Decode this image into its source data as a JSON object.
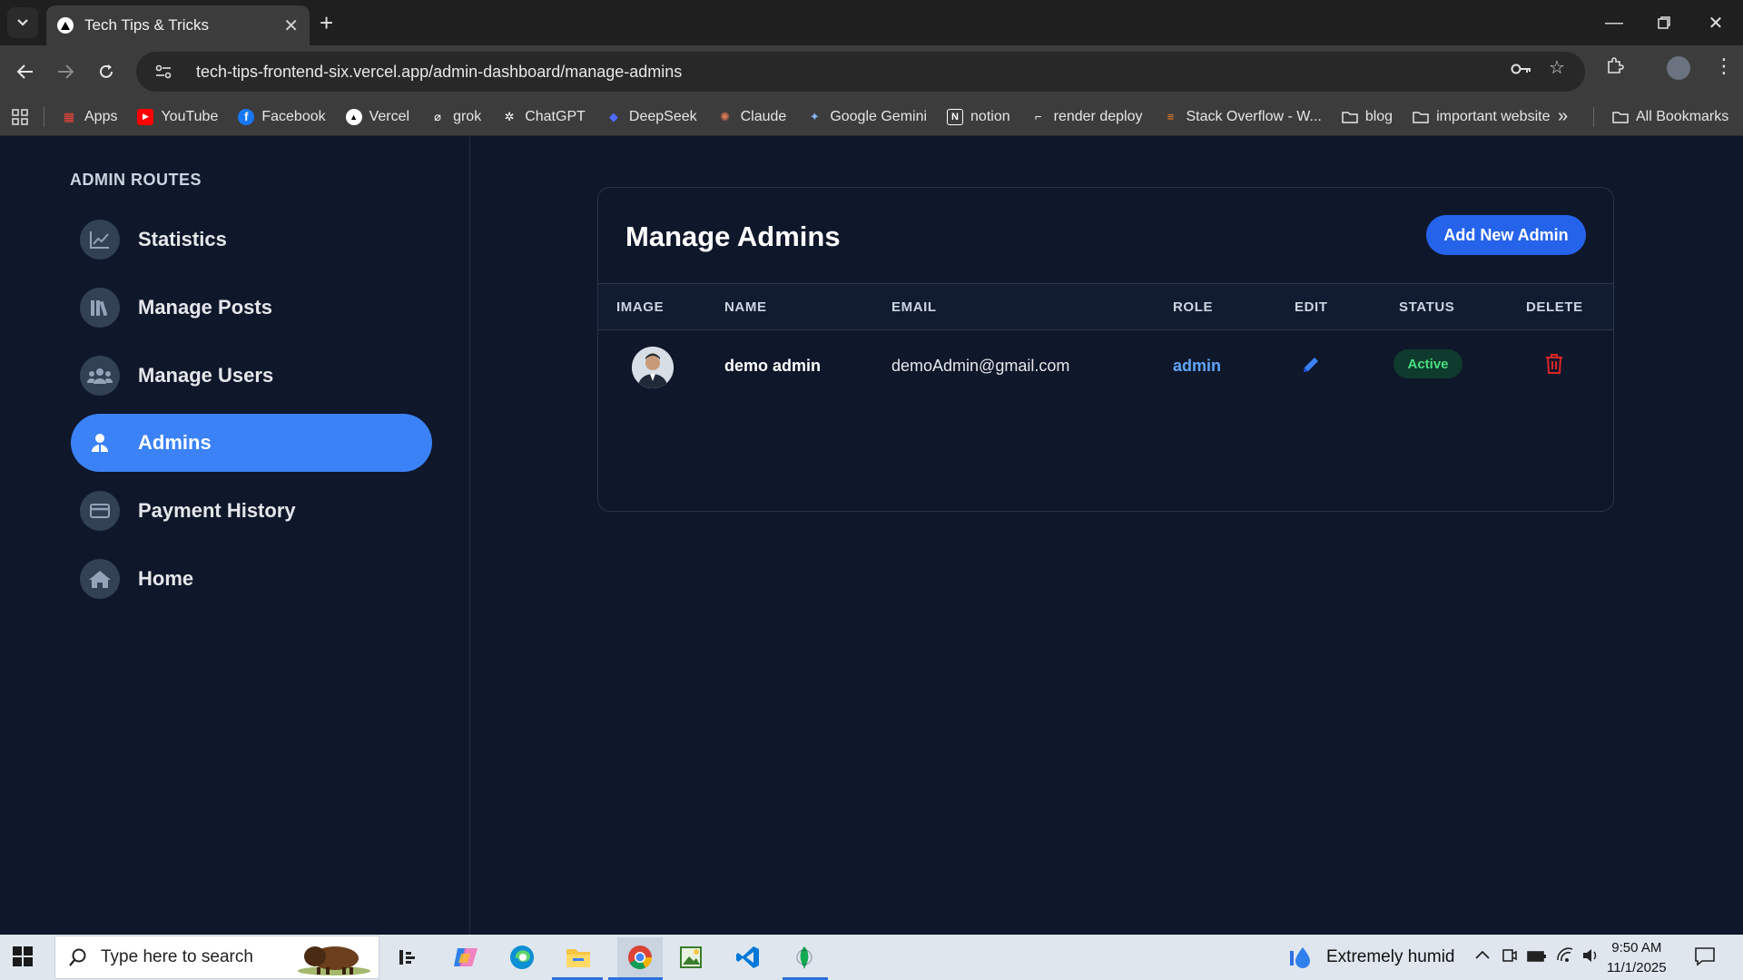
{
  "browser": {
    "tab_title": "Tech Tips & Tricks",
    "url": "tech-tips-frontend-six.vercel.app/admin-dashboard/manage-admins",
    "bookmarks": [
      {
        "label": "Apps",
        "icon": "apps-grid-icon",
        "color": "#e8453c"
      },
      {
        "label": "YouTube",
        "icon": "youtube-icon",
        "color": "#ff0000"
      },
      {
        "label": "Facebook",
        "icon": "facebook-icon",
        "color": "#1877f2"
      },
      {
        "label": "Vercel",
        "icon": "vercel-icon",
        "color": "#ffffff"
      },
      {
        "label": "grok",
        "icon": "grok-icon",
        "color": "#ffffff"
      },
      {
        "label": "ChatGPT",
        "icon": "chatgpt-icon",
        "color": "#ffffff"
      },
      {
        "label": "DeepSeek",
        "icon": "deepseek-icon",
        "color": "#4d6bfe"
      },
      {
        "label": "Claude",
        "icon": "claude-icon",
        "color": "#d97757"
      },
      {
        "label": "Google Gemini",
        "icon": "gemini-icon",
        "color": "#8ab4f8"
      },
      {
        "label": "notion",
        "icon": "notion-icon",
        "color": "#ffffff"
      },
      {
        "label": "render deploy",
        "icon": "render-icon",
        "color": "#ffffff"
      },
      {
        "label": "Stack Overflow - W...",
        "icon": "stackoverflow-icon",
        "color": "#f48024"
      },
      {
        "label": "blog",
        "icon": "folder-icon",
        "color": "#e6e6e6"
      },
      {
        "label": "important website",
        "icon": "folder-icon",
        "color": "#e6e6e6"
      }
    ],
    "all_bookmarks_label": "All Bookmarks"
  },
  "sidebar": {
    "heading": "ADMIN ROUTES",
    "items": [
      {
        "label": "Statistics",
        "icon": "chart-line-icon",
        "active": false
      },
      {
        "label": "Manage Posts",
        "icon": "books-icon",
        "active": false
      },
      {
        "label": "Manage Users",
        "icon": "users-icon",
        "active": false
      },
      {
        "label": "Admins",
        "icon": "user-shield-icon",
        "active": true
      },
      {
        "label": "Payment History",
        "icon": "credit-card-icon",
        "active": false
      },
      {
        "label": "Home",
        "icon": "home-icon",
        "active": false
      }
    ]
  },
  "main": {
    "title": "Manage Admins",
    "add_button_label": "Add New Admin",
    "table": {
      "headers": [
        "IMAGE",
        "NAME",
        "EMAIL",
        "ROLE",
        "EDIT",
        "STATUS",
        "DELETE"
      ],
      "rows": [
        {
          "name": "demo admin",
          "email": "demoAdmin@gmail.com",
          "role": "admin",
          "status": "Active"
        }
      ]
    }
  },
  "taskbar": {
    "search_placeholder": "Type here to search",
    "weather": "Extremely humid",
    "time": "9:50 AM",
    "date": "11/1/2025"
  },
  "colors": {
    "accent": "#3b82f6",
    "button": "#2563eb",
    "status_active": "#4ade80",
    "delete": "#dc2626",
    "background": "#0f172a"
  }
}
